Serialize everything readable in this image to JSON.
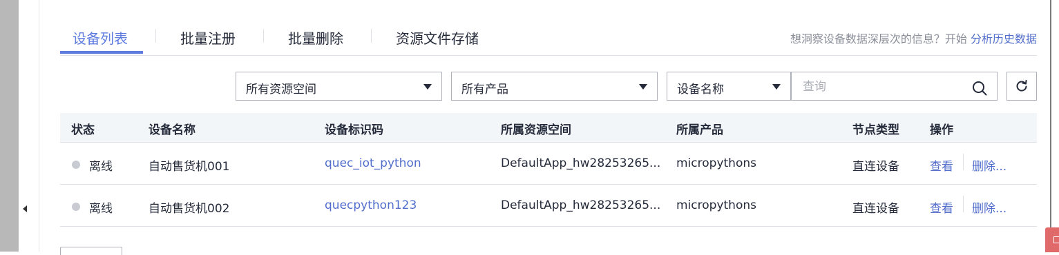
{
  "tabs": [
    {
      "label": "设备列表",
      "active": true
    },
    {
      "label": "批量注册",
      "active": false
    },
    {
      "label": "批量删除",
      "active": false
    },
    {
      "label": "资源文件存储",
      "active": false
    }
  ],
  "insight": {
    "prefix": "想洞察设备数据深层次的信息？开始",
    "link": "分析历史数据"
  },
  "filters": {
    "resource_space": "所有资源空间",
    "product": "所有产品",
    "search_field": "设备名称",
    "search_placeholder": "查询"
  },
  "table": {
    "headers": [
      "状态",
      "设备名称",
      "设备标识码",
      "所属资源空间",
      "所属产品",
      "节点类型",
      "操作"
    ],
    "rows": [
      {
        "status": "离线",
        "name": "自动售货机001",
        "identifier": "quec_iot_python",
        "resource_space": "DefaultApp_hw28253265...",
        "product": "micropythons",
        "node_type": "直连设备",
        "view": "查看",
        "delete": "删除..."
      },
      {
        "status": "离线",
        "name": "自动售货机002",
        "identifier": "quecpython123",
        "resource_space": "DefaultApp_hw28253265...",
        "product": "micropythons",
        "node_type": "直连设备",
        "view": "查看",
        "delete": "删除..."
      }
    ]
  },
  "colors": {
    "accent": "#5e7ce0",
    "link": "#526ecc",
    "offline_dot": "#c8cbd2",
    "header_bg": "#f3f6f8"
  },
  "icons": {
    "search": "search-icon",
    "refresh": "refresh-icon",
    "collapse": "chevron-left-icon"
  }
}
